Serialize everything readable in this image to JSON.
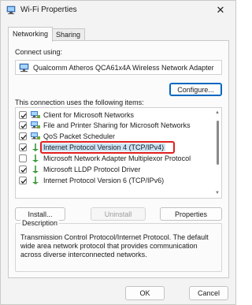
{
  "window": {
    "title": "Wi-Fi Properties",
    "close_glyph": "✕"
  },
  "tabs": [
    {
      "label": "Networking",
      "active": true
    },
    {
      "label": "Sharing",
      "active": false
    }
  ],
  "connect_using": {
    "label": "Connect using:",
    "adapter": "Qualcomm Atheros QCA61x4A Wireless Network Adapter",
    "icon": "network-adapter-icon"
  },
  "configure_button": "Configure...",
  "items_label": "This connection uses the following items:",
  "items": [
    {
      "label": "Client for Microsoft Networks",
      "checked": true,
      "icon": "network-client-icon",
      "selected": false
    },
    {
      "label": "File and Printer Sharing for Microsoft Networks",
      "checked": true,
      "icon": "network-client-icon",
      "selected": false
    },
    {
      "label": "QoS Packet Scheduler",
      "checked": true,
      "icon": "network-client-icon",
      "selected": false
    },
    {
      "label": "Internet Protocol Version 4 (TCP/IPv4)",
      "checked": true,
      "icon": "protocol-icon",
      "selected": true
    },
    {
      "label": "Microsoft Network Adapter Multiplexor Protocol",
      "checked": false,
      "icon": "protocol-icon",
      "selected": false
    },
    {
      "label": "Microsoft LLDP Protocol Driver",
      "checked": true,
      "icon": "protocol-icon",
      "selected": false
    },
    {
      "label": "Internet Protocol Version 6 (TCP/IPv6)",
      "checked": true,
      "icon": "protocol-icon",
      "selected": false
    }
  ],
  "buttons": {
    "install": "Install...",
    "uninstall": "Uninstall",
    "properties": "Properties"
  },
  "description": {
    "legend": "Description",
    "text": "Transmission Control Protocol/Internet Protocol. The default wide area network protocol that provides communication across diverse interconnected networks."
  },
  "footer": {
    "ok": "OK",
    "cancel": "Cancel"
  },
  "colors": {
    "accent": "#0067c0",
    "highlight": "#e02020",
    "selection": "#cce4f7"
  }
}
